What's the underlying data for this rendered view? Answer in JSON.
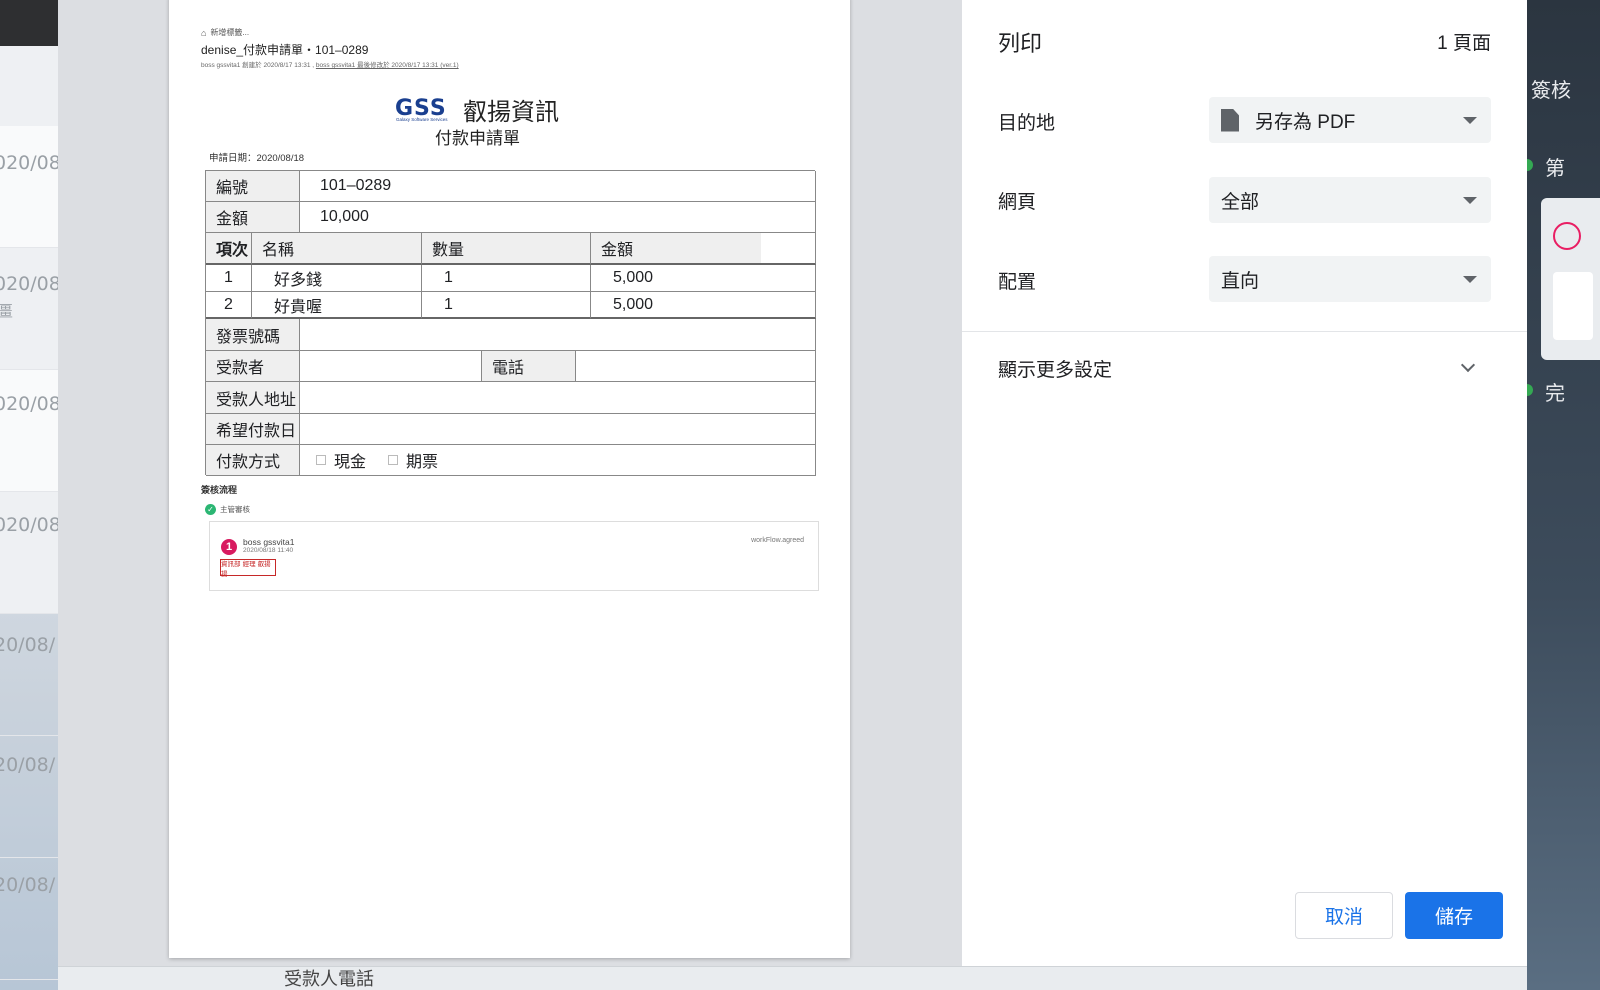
{
  "background": {
    "left_dates": [
      "020/08/",
      "020/08/",
      "020/08",
      "020/08",
      "20/08/",
      "20/08/",
      "20/08/"
    ],
    "left_sub": [
      "",
      "畺",
      "",
      "",
      "",
      "",
      ""
    ],
    "right_texts": [
      "簽核",
      "第",
      "完"
    ],
    "bottom_text": "受款人電話"
  },
  "paper": {
    "tag_label": "新增標籤...",
    "title": "denise_付款申請單・101–0289",
    "meta_created": "boss gssvita1 創建於 2020/8/17 13:31 ,",
    "meta_modified": "boss gssvita1 最後修改於 2020/8/17 13:31 (ver.1)",
    "logo_letters": "GSS",
    "logo_subtitle": "Galaxy Software Services",
    "company_name": "叡揚資訊",
    "form_title": "付款申請單",
    "apply_date": "申請日期：2020/08/18",
    "fields": {
      "number_label": "編號",
      "number_value": "101–0289",
      "amount_label": "金額",
      "amount_value": "10,000"
    },
    "items_headers": [
      "項次",
      "名稱",
      "數量",
      "金額"
    ],
    "items": [
      {
        "no": "1",
        "name": "好多錢",
        "qty": "1",
        "amount": "5,000"
      },
      {
        "no": "2",
        "name": "好貴喔",
        "qty": "1",
        "amount": "5,000"
      }
    ],
    "invoice_label": "發票號碼",
    "payee_label": "受款者",
    "phone_label": "電話",
    "address_label": "受款人地址",
    "due_label": "希望付款日",
    "method_label": "付款方式",
    "method_options": [
      "現金",
      "期票"
    ],
    "flow_title": "簽核流程",
    "flow_step": "主管審核",
    "approver": "boss gssvita1",
    "approve_time": "2020/08/18 11:40",
    "approve_status": "workFlow.agreed",
    "stamp_text": "資訊部 經理 叡揚揚",
    "badge": "1"
  },
  "settings": {
    "header": "列印",
    "page_count": "1 頁面",
    "destination_label": "目的地",
    "destination_value": "另存為 PDF",
    "pages_label": "網頁",
    "pages_value": "全部",
    "layout_label": "配置",
    "layout_value": "直向",
    "more_settings": "顯示更多設定",
    "cancel": "取消",
    "save": "儲存"
  },
  "colors": {
    "accent": "#1a73e8",
    "logo": "#1a3f8f",
    "stamp": "#c62828",
    "badge": "#d81b60"
  }
}
